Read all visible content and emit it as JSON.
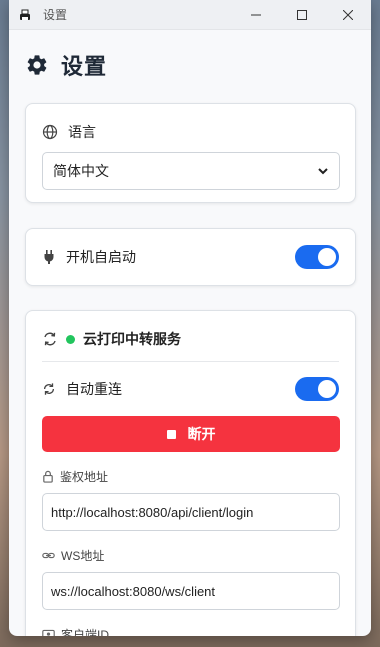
{
  "window": {
    "title": "设置"
  },
  "page": {
    "title": "设置"
  },
  "language": {
    "label": "语言",
    "selected": "简体中文"
  },
  "autostart": {
    "label": "开机自启动",
    "enabled": true
  },
  "relay": {
    "title": "云打印中转服务",
    "status_color": "#22c55e",
    "auto_reconnect_label": "自动重连",
    "auto_reconnect_enabled": true,
    "disconnect_label": "断开",
    "auth_label": "鉴权地址",
    "auth_value": "http://localhost:8080/api/client/login",
    "ws_label": "WS地址",
    "ws_value": "ws://localhost:8080/ws/client",
    "client_id_label": "客户端ID"
  },
  "colors": {
    "accent": "#1a6bf0",
    "danger": "#f5333f",
    "online": "#22c55e"
  }
}
